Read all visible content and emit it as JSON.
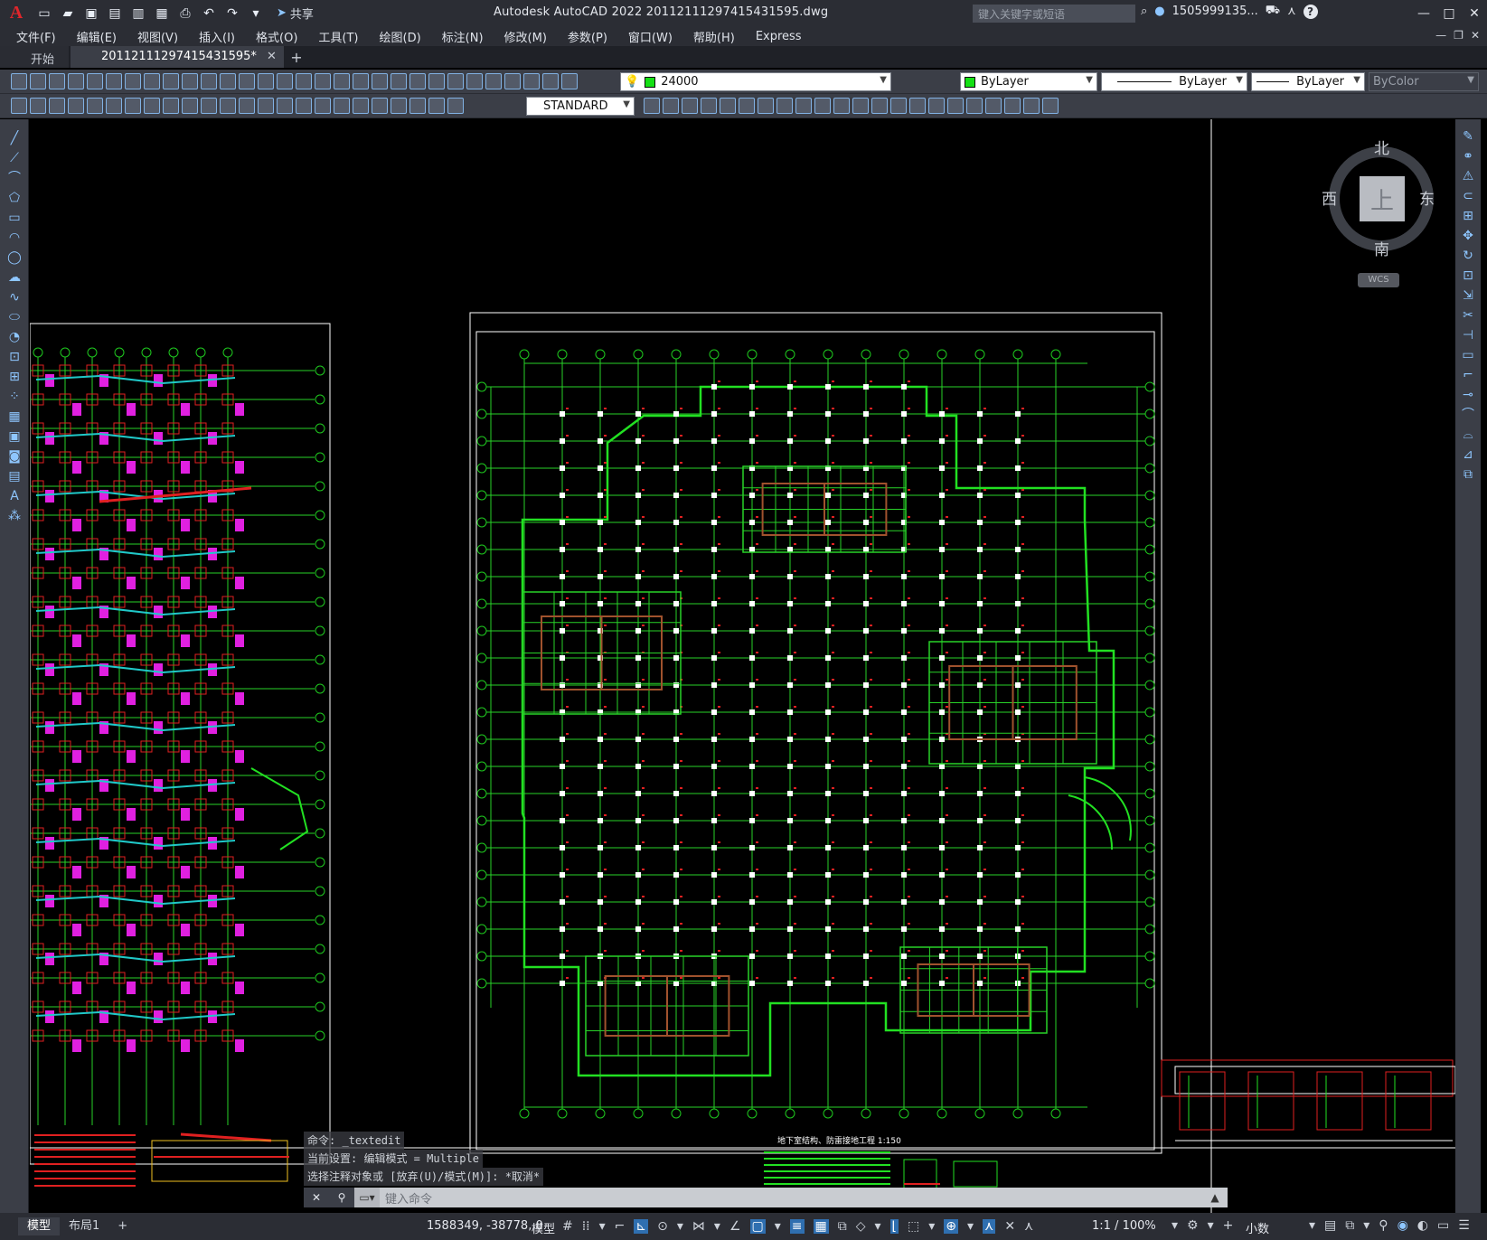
{
  "titlebar": {
    "app_logo": "A",
    "share_label": "共享",
    "title": "Autodesk AutoCAD 2022    20112111297415431595.dwg",
    "search_placeholder": "键入关键字或短语",
    "user": "1505999135...",
    "help": "?"
  },
  "menu": [
    "文件(F)",
    "编辑(E)",
    "视图(V)",
    "插入(I)",
    "格式(O)",
    "工具(T)",
    "绘图(D)",
    "标注(N)",
    "修改(M)",
    "参数(P)",
    "窗口(W)",
    "帮助(H)",
    "Express"
  ],
  "tabs": {
    "start": "开始",
    "drawing": "20112111297415431595*",
    "close": "✕",
    "add": "+"
  },
  "toolbar": {
    "layer": "24000",
    "color": "ByLayer",
    "linetype": "ByLayer",
    "lineweight": "ByLayer",
    "plotstyle": "ByColor",
    "textstyle": "STANDARD"
  },
  "viewcube": {
    "top": "上",
    "north": "北",
    "south": "南",
    "east": "东",
    "west": "西",
    "wcs": "WCS"
  },
  "command": {
    "history": [
      "命令: _textedit",
      "当前设置: 编辑模式 = Multiple",
      "选择注释对象或 [放弃(U)/模式(M)]: *取消*"
    ],
    "placeholder": "键入命令"
  },
  "status": {
    "model_tab": "模型",
    "layout_tab": "布局1",
    "add_tab": "+",
    "coords": "1588349, -38778, 0",
    "space": "模型",
    "scale": "1:1 / 100%",
    "units": "小数"
  },
  "drawing": {
    "plan_title": "地下室结构、防雷接地工程  1:150"
  },
  "colors": {
    "grid": "#28d228",
    "axis": "#1ec81e",
    "column_marks": "#ffffff",
    "red_marks": "#e02020",
    "magenta": "#e020e0",
    "cyan": "#20c8c8",
    "brown": "#a0522d"
  }
}
